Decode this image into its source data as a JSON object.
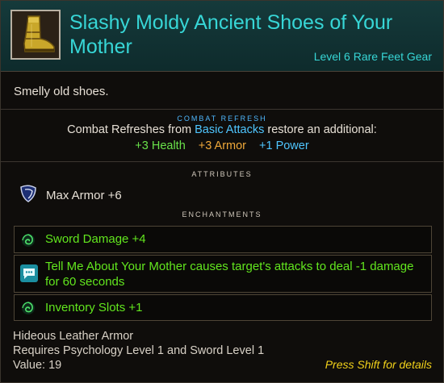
{
  "item": {
    "title": "Slashy Moldy Ancient Shoes of Your Mother",
    "subtitle": "Level 6 Rare Feet Gear",
    "description": "Smelly old shoes.",
    "icon": "boot-icon"
  },
  "combat_refresh": {
    "label": "COMBAT REFRESH",
    "line_prefix": "Combat Refreshes from ",
    "line_highlight": "Basic Attacks",
    "line_suffix": " restore an additional:",
    "health": "+3 Health",
    "armor": "+3 Armor",
    "power": "+1 Power"
  },
  "attributes": {
    "label": "ATTRIBUTES",
    "items": [
      {
        "icon": "armor-shield-icon",
        "text": "Max Armor +6"
      }
    ]
  },
  "enchantments": {
    "label": "ENCHANTMENTS",
    "items": [
      {
        "icon": "swirl-rune-icon",
        "text": "Sword Damage +4"
      },
      {
        "icon": "speech-bubble-icon",
        "line1": "Tell Me About Your Mother causes target's attacks to deal -1 damage",
        "line2": "for 60 seconds"
      },
      {
        "icon": "swirl-rune-icon",
        "text": "Inventory Slots +1"
      }
    ]
  },
  "footer": {
    "armor_type": "Hideous Leather Armor",
    "requirements": "Requires Psychology Level 1 and Sword Level 1",
    "value": "Value: 19",
    "hint": "Press Shift for details"
  },
  "colors": {
    "title": "#37d6d6",
    "enchantment": "#62e61e",
    "hint": "#f2d21a",
    "health": "#69e24a",
    "armor": "#f0a93a",
    "power": "#4fc6ff"
  }
}
